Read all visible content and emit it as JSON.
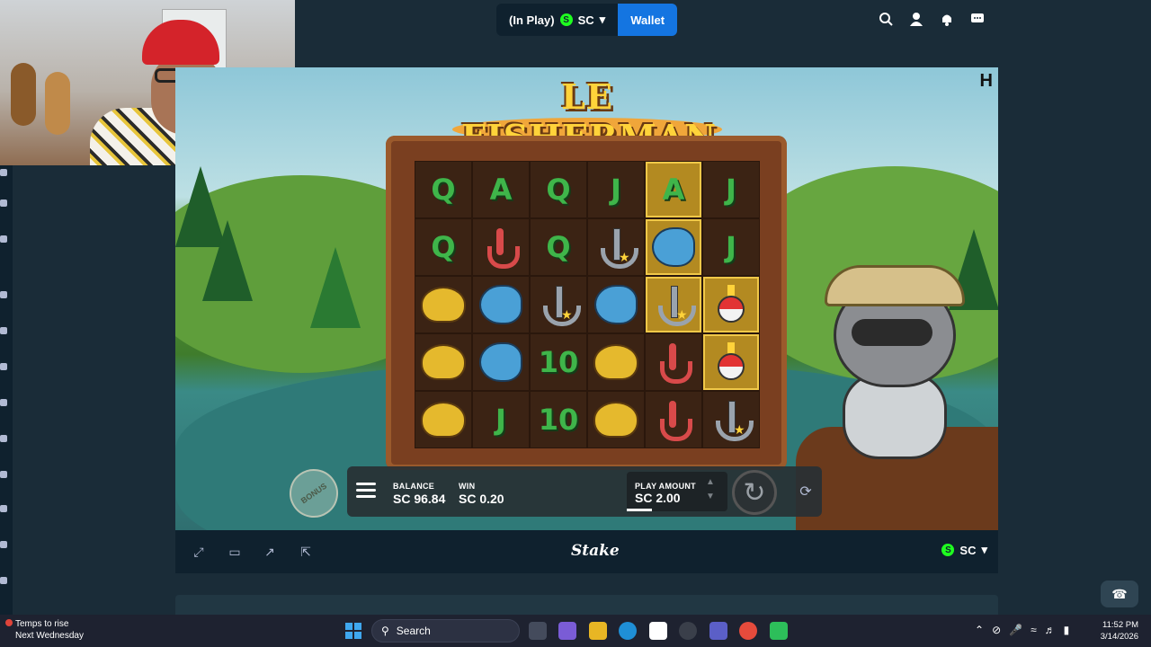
{
  "topbar": {
    "status_label": "(In Play)",
    "currency_code": "SC",
    "currency_symbol": "S",
    "wallet_label": "Wallet",
    "icons": [
      "search-icon",
      "user-icon",
      "notification-icon",
      "chat-icon"
    ]
  },
  "game": {
    "title": "LE FISHERMAN",
    "provider_logo": "H",
    "grid": [
      [
        {
          "t": "Q"
        },
        {
          "t": "A"
        },
        {
          "t": "Q"
        },
        {
          "t": "J"
        },
        {
          "t": "A",
          "hl": true
        },
        {
          "t": "J"
        }
      ],
      [
        {
          "t": "Q"
        },
        {
          "s": "hook"
        },
        {
          "t": "Q"
        },
        {
          "s": "anchor"
        },
        {
          "s": "fish",
          "hl": true
        },
        {
          "t": "J"
        }
      ],
      [
        {
          "s": "helmet"
        },
        {
          "s": "fish"
        },
        {
          "s": "anchor"
        },
        {
          "s": "fish"
        },
        {
          "s": "anchor",
          "hl": true
        },
        {
          "s": "bobber",
          "hl": true
        }
      ],
      [
        {
          "s": "helmet"
        },
        {
          "s": "fish"
        },
        {
          "t": "10"
        },
        {
          "s": "helmet"
        },
        {
          "s": "hook"
        },
        {
          "s": "bobber",
          "hl": true
        }
      ],
      [
        {
          "s": "helmet"
        },
        {
          "t": "J"
        },
        {
          "t": "10"
        },
        {
          "s": "helmet"
        },
        {
          "s": "hook"
        },
        {
          "s": "anchor"
        }
      ]
    ],
    "bonus_label": "BONUS",
    "balance_label": "BALANCE",
    "balance_value": "SC 96.84",
    "win_label": "WIN",
    "win_value": "SC 0.20",
    "play_amount_label": "PLAY AMOUNT",
    "play_amount_value": "SC 2.00"
  },
  "footer": {
    "brand": "Stake",
    "currency_code": "SC",
    "currency_symbol": "S"
  },
  "taskbar": {
    "weather_line1": "Temps to rise",
    "weather_line2": "Next Wednesday",
    "search_label": "Search",
    "time": "11:52 PM",
    "date": "3/14/2026"
  }
}
